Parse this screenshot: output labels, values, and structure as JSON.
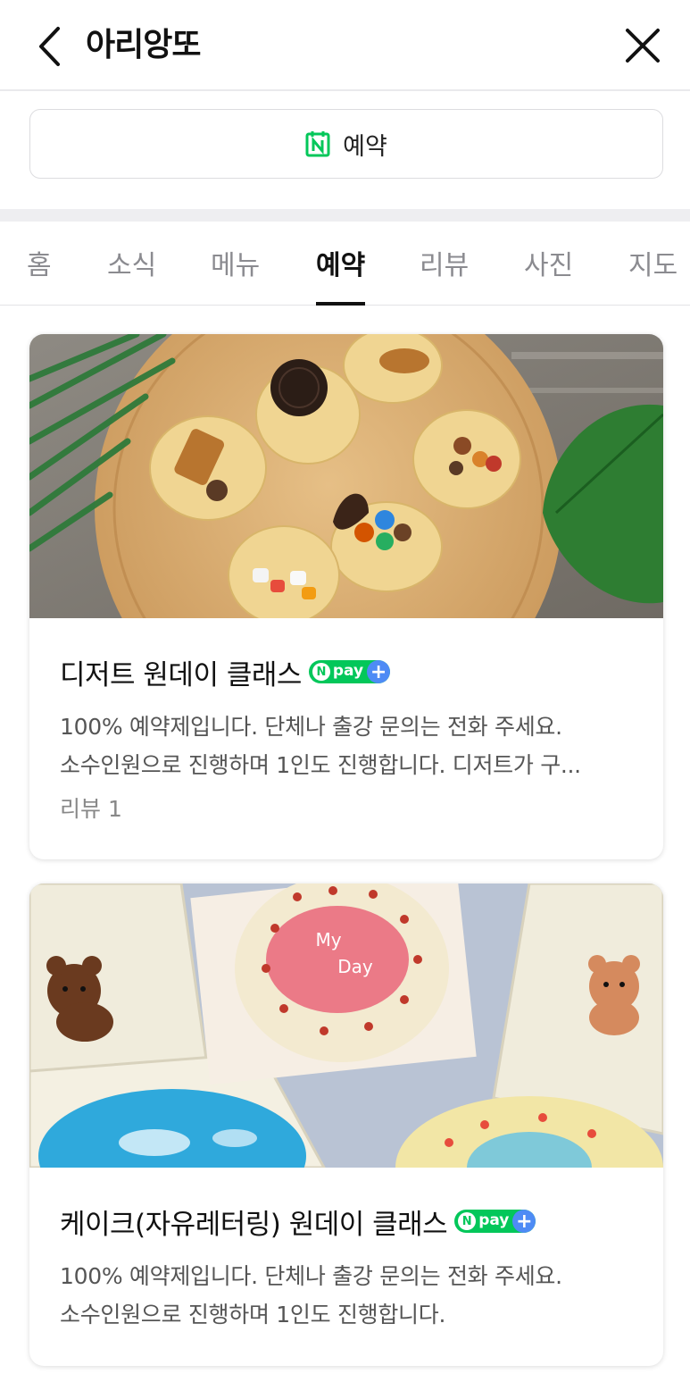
{
  "header": {
    "title": "아리앙또",
    "back_icon": "chevron-left-icon",
    "close_icon": "close-icon"
  },
  "reservation_button": {
    "label": "예약",
    "icon": "naver-calendar-icon",
    "icon_color": "#03c75a"
  },
  "tabs": [
    {
      "label": "홈"
    },
    {
      "label": "소식"
    },
    {
      "label": "메뉴"
    },
    {
      "label": "예약",
      "active": true
    },
    {
      "label": "리뷰"
    },
    {
      "label": "사진"
    },
    {
      "label": "지도"
    }
  ],
  "cards": [
    {
      "title": "디저트 원데이 클래스",
      "badge": "pay",
      "desc_line1": "100% 예약제입니다. 단체나 출강 문의는 전화 주세요.",
      "desc_line2": "소수인원으로 진행하며 1인도 진행합니다. 디저트가 구...",
      "review": "리뷰 1",
      "image": "cookies-photo"
    },
    {
      "title": "케이크(자유레터링) 원데이 클래스",
      "badge": "pay",
      "desc_line1": "100% 예약제입니다. 단체나 출강 문의는 전화 주세요.",
      "desc_line2": "소수인원으로 진행하며 1인도 진행합니다.",
      "image": "cakes-photo",
      "cake_text": "My Day"
    }
  ],
  "colors": {
    "naver_green": "#03c75a",
    "npay_plus_blue": "#4e8bf5",
    "tab_inactive": "#8b8b90"
  }
}
